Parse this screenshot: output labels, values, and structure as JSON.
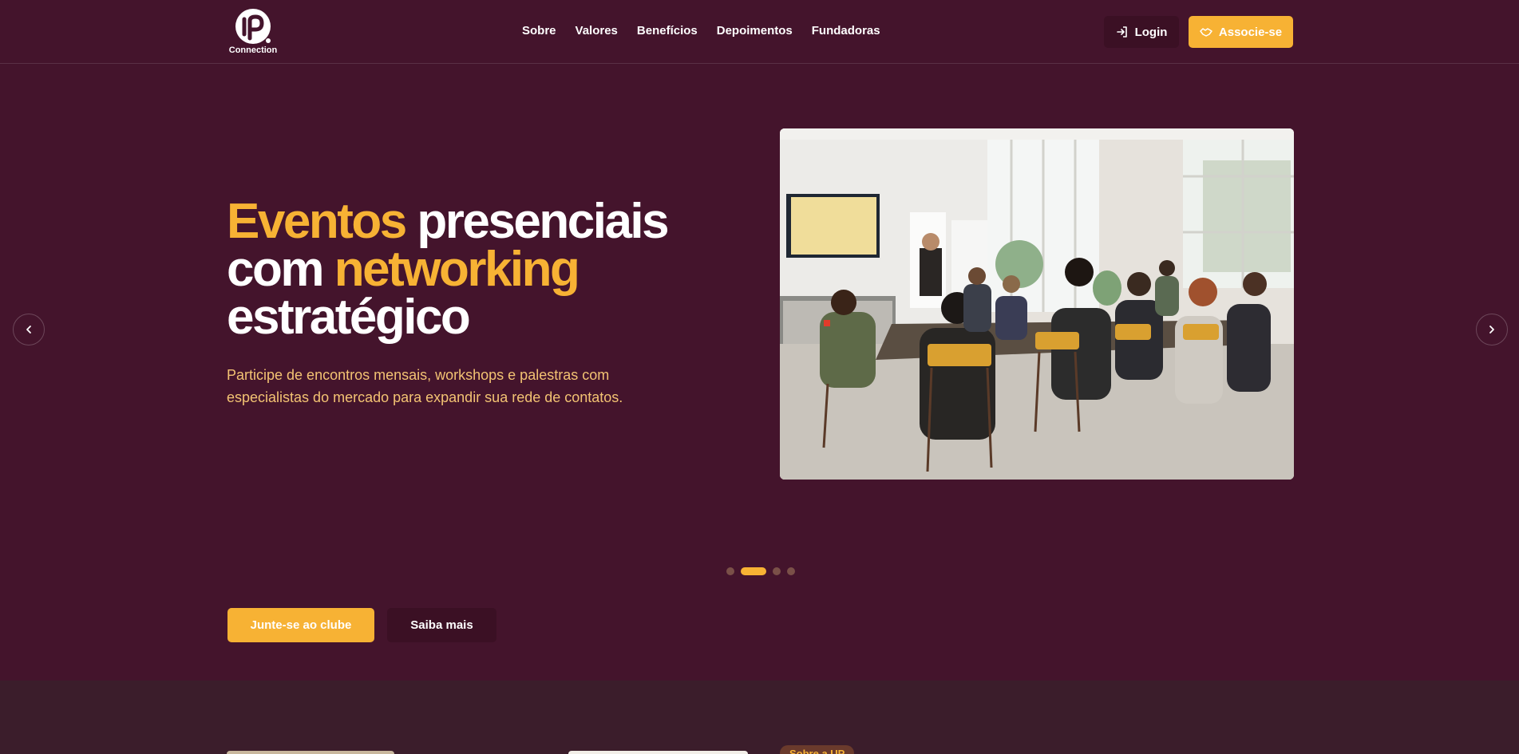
{
  "header": {
    "logo_text": "Connection",
    "nav": [
      "Sobre",
      "Valores",
      "Benefícios",
      "Depoimentos",
      "Fundadoras"
    ],
    "login_label": "Login",
    "associe_label": "Associe-se"
  },
  "hero": {
    "title_word1": "Eventos",
    "title_word2": " presenciais",
    "title_word3": "com ",
    "title_word4": "networking",
    "title_word5": "estratégico",
    "description": "Participe de encontros mensais, workshops e palestras com especialistas do mercado para expandir sua rede de contatos.",
    "image_alt": "Pessoas sentadas em uma sala de reunião assistindo a uma apresentação",
    "carousel_total": 4,
    "carousel_active": 2,
    "cta_primary": "Junte-se ao clube",
    "cta_secondary": "Saiba mais"
  },
  "next_section": {
    "badge": "Sobre a UP"
  },
  "colors": {
    "background": "#44142c",
    "accent": "#f7b234",
    "dark_button": "#3b1024",
    "description": "#f3c373"
  },
  "icons": {
    "login": "log-in-icon",
    "associe": "handshake-icon",
    "prev": "chevron-left-icon",
    "next": "chevron-right-icon"
  }
}
